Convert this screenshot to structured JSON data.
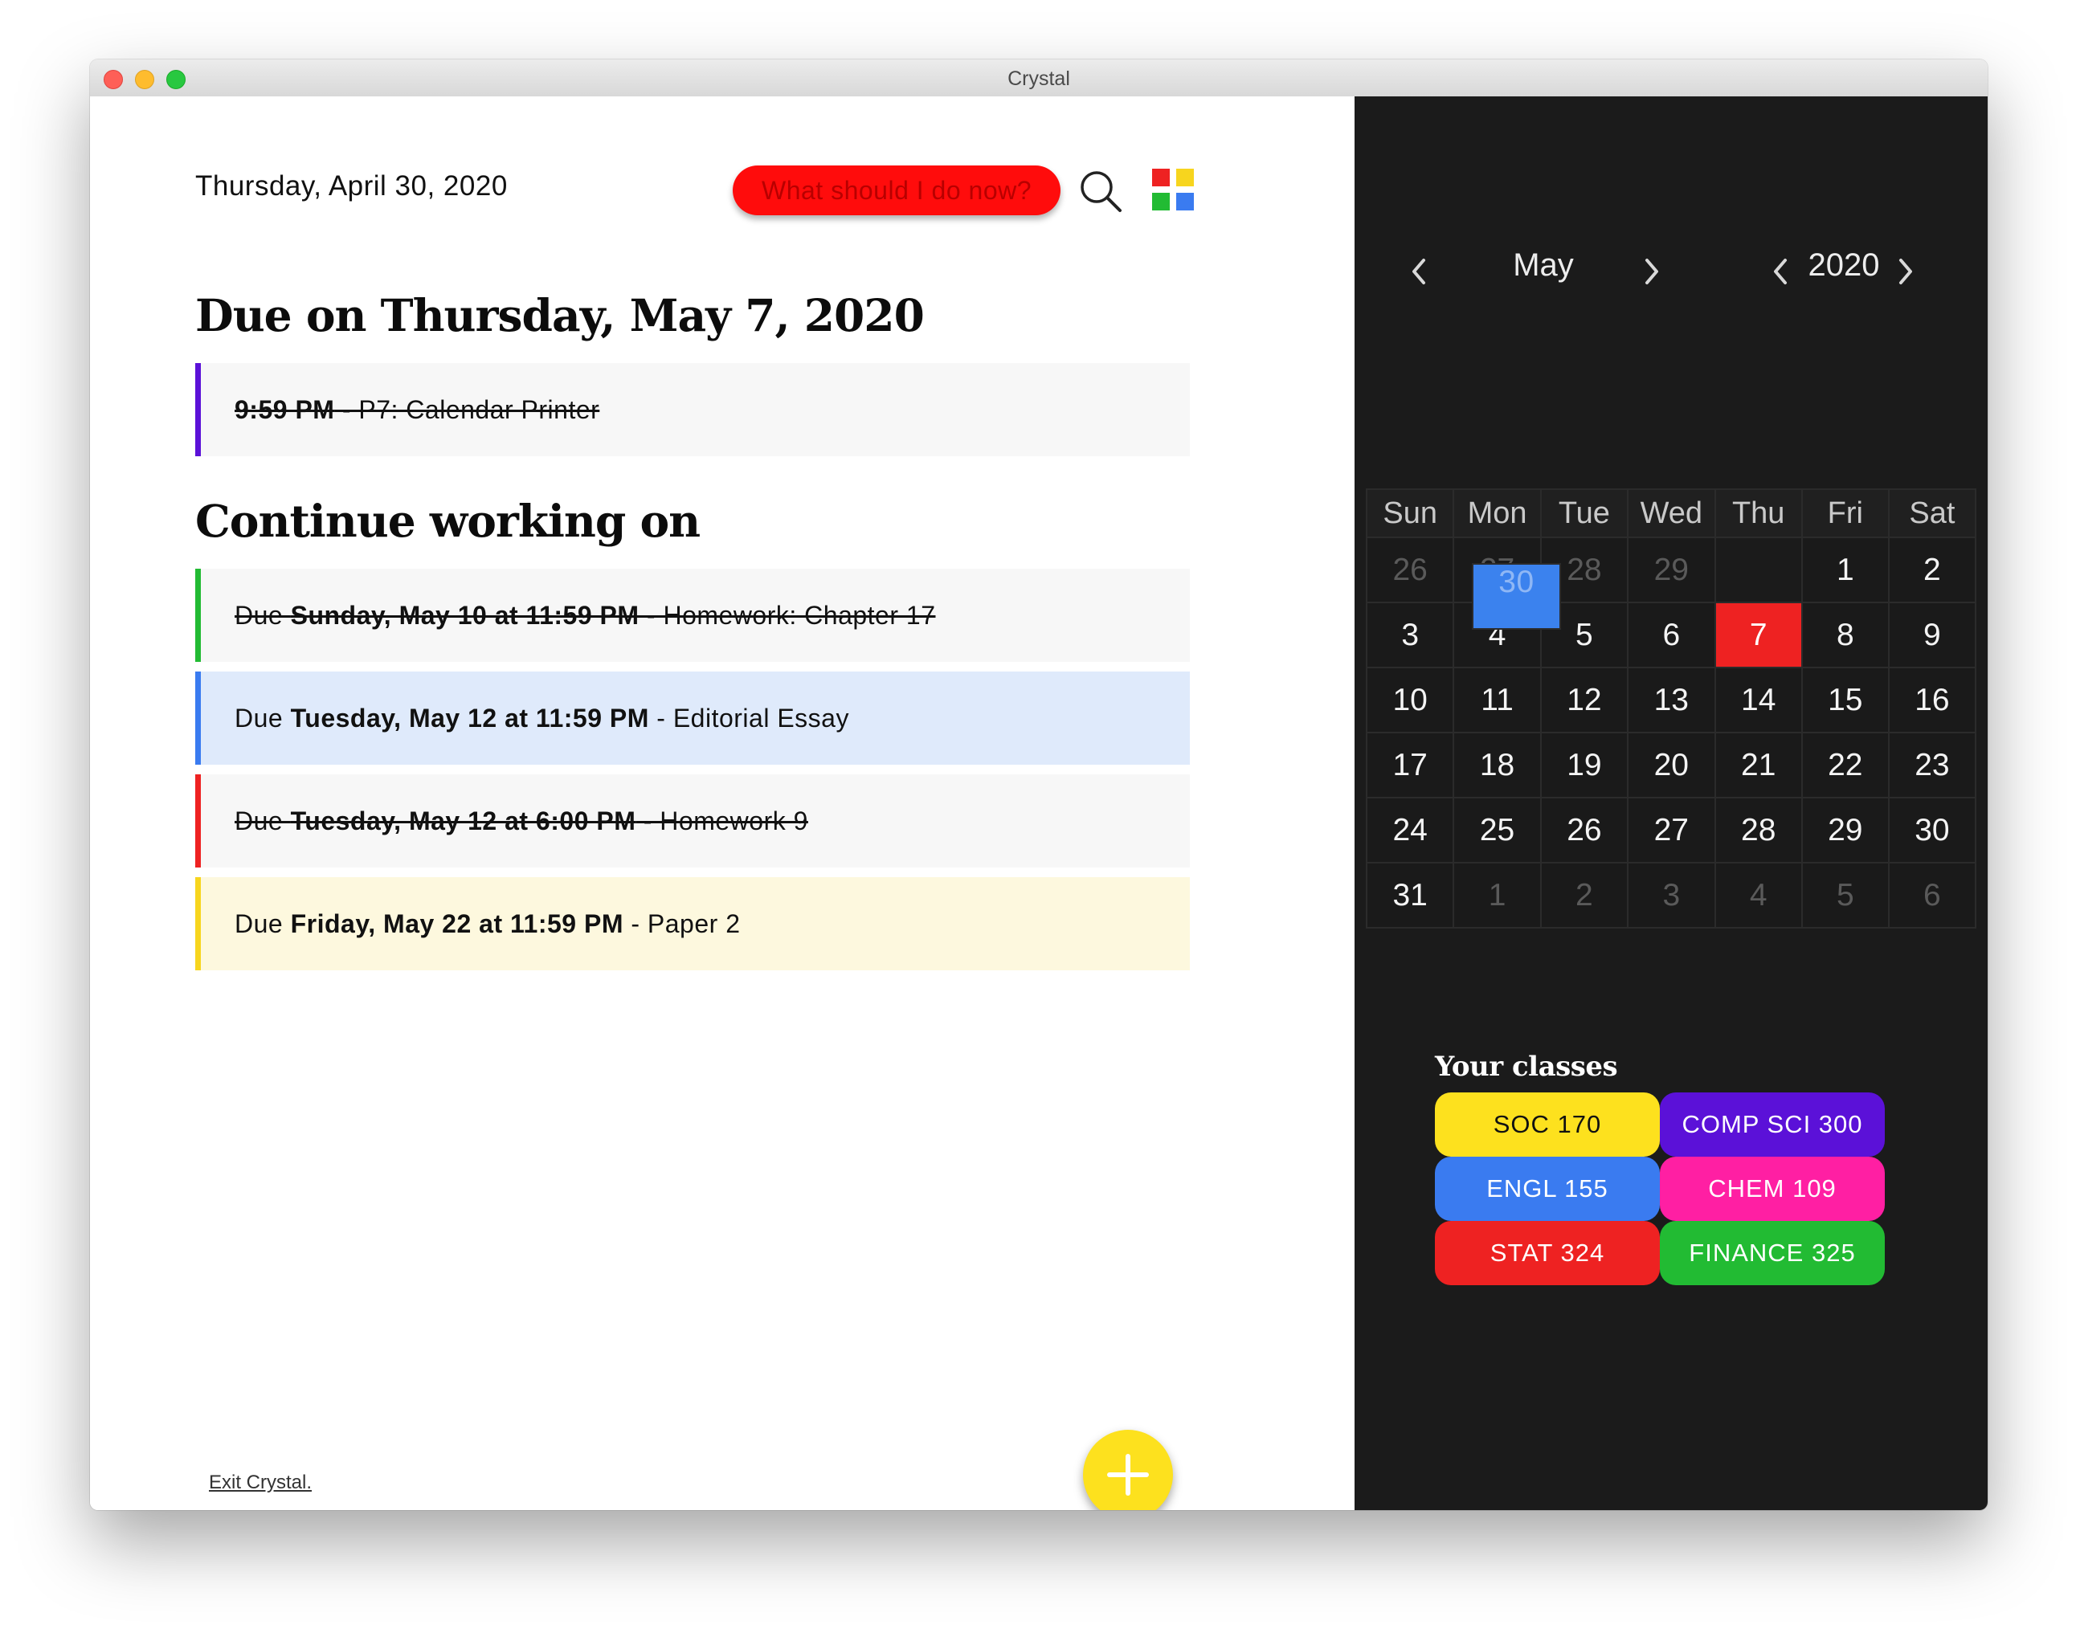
{
  "window": {
    "title": "Crystal"
  },
  "header": {
    "date": "Thursday, April 30, 2020",
    "suggest_button": "What should I do now?",
    "search_icon": "search-icon",
    "apps_icon": "grid-icon"
  },
  "due_section": {
    "heading": "Due on Thursday, May 7, 2020",
    "tasks": [
      {
        "time": "9:59 PM",
        "title": " - P7: Calendar Printer",
        "color": "#5b11d8",
        "completed": true
      }
    ]
  },
  "continue_section": {
    "heading": "Continue working on",
    "tasks": [
      {
        "prefix": "Due ",
        "when": "Sunday, May 10 at 11:59 PM",
        "title": " - Homework: Chapter 17",
        "color": "#22bb33",
        "background": "#f7f7f7",
        "completed": true
      },
      {
        "prefix": "Due ",
        "when": "Tuesday, May 12 at 11:59 PM",
        "title": " - Editorial Essay",
        "color": "#3a7bf0",
        "background": "#dfeafb",
        "completed": false
      },
      {
        "prefix": "Due ",
        "when": "Tuesday, May 12 at 6:00 PM",
        "title": " - Homework 9",
        "color": "#ee2222",
        "background": "#f7f7f7",
        "completed": true
      },
      {
        "prefix": "Due ",
        "when": "Friday, May 22 at 11:59 PM",
        "title": " - Paper 2",
        "color": "#f7d51e",
        "background": "#fdf8de",
        "completed": false
      }
    ]
  },
  "footer": {
    "exit_link": "Exit Crystal."
  },
  "fab": {
    "icon": "plus-icon"
  },
  "calendar": {
    "month": "May",
    "year": "2020",
    "weekdays": [
      "Sun",
      "Mon",
      "Tue",
      "Wed",
      "Thu",
      "Fri",
      "Sat"
    ],
    "weeks": [
      [
        {
          "d": "26",
          "o": 1
        },
        {
          "d": "27",
          "o": 1
        },
        {
          "d": "28",
          "o": 1
        },
        {
          "d": "29",
          "o": 1
        },
        {
          "d": "30",
          "o": 1,
          "s": "today"
        },
        {
          "d": "1"
        },
        {
          "d": "2"
        }
      ],
      [
        {
          "d": "3"
        },
        {
          "d": "4"
        },
        {
          "d": "5"
        },
        {
          "d": "6"
        },
        {
          "d": "7",
          "s": "due"
        },
        {
          "d": "8"
        },
        {
          "d": "9"
        }
      ],
      [
        {
          "d": "10"
        },
        {
          "d": "11"
        },
        {
          "d": "12"
        },
        {
          "d": "13"
        },
        {
          "d": "14"
        },
        {
          "d": "15"
        },
        {
          "d": "16"
        }
      ],
      [
        {
          "d": "17"
        },
        {
          "d": "18"
        },
        {
          "d": "19"
        },
        {
          "d": "20"
        },
        {
          "d": "21"
        },
        {
          "d": "22"
        },
        {
          "d": "23"
        }
      ],
      [
        {
          "d": "24"
        },
        {
          "d": "25"
        },
        {
          "d": "26"
        },
        {
          "d": "27"
        },
        {
          "d": "28"
        },
        {
          "d": "29"
        },
        {
          "d": "30"
        }
      ],
      [
        {
          "d": "31"
        },
        {
          "d": "1",
          "o": 1
        },
        {
          "d": "2",
          "o": 1
        },
        {
          "d": "3",
          "o": 1
        },
        {
          "d": "4",
          "o": 1
        },
        {
          "d": "5",
          "o": 1
        },
        {
          "d": "6",
          "o": 1
        }
      ]
    ]
  },
  "classes": {
    "title": "Your classes",
    "items": [
      {
        "label": "SOC 170",
        "color": "#fde11e",
        "text_color": "#111111"
      },
      {
        "label": "COMP SCI 300",
        "color": "#5b11d8",
        "text_color": "#ffffff"
      },
      {
        "label": "ENGL 155",
        "color": "#3a7bf0",
        "text_color": "#ffffff"
      },
      {
        "label": "CHEM 109",
        "color": "#ff1fa3",
        "text_color": "#ffffff"
      },
      {
        "label": "STAT 324",
        "color": "#ee2222",
        "text_color": "#ffffff"
      },
      {
        "label": "FINANCE 325",
        "color": "#22bb33",
        "text_color": "#ffffff"
      }
    ]
  }
}
